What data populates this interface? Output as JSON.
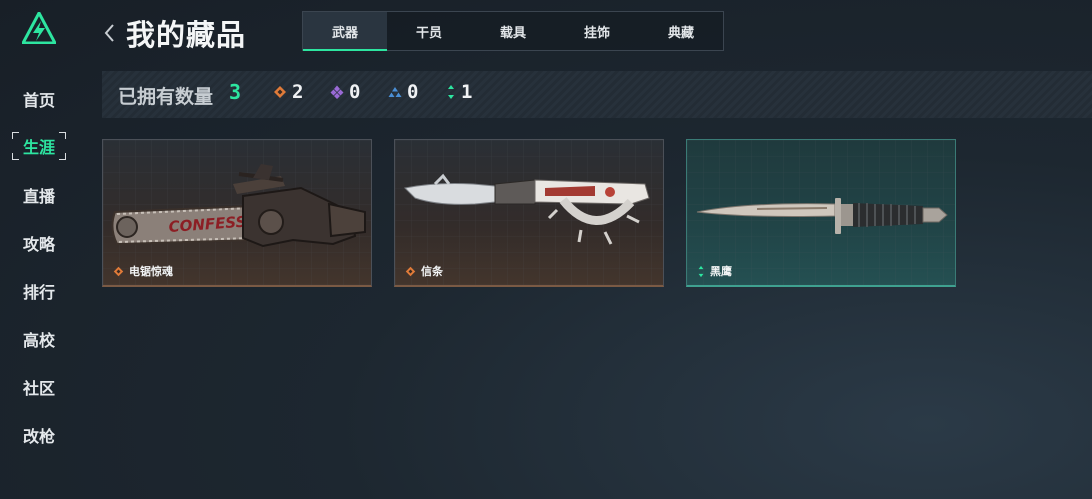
{
  "page": {
    "title": "我的藏品",
    "back_icon": "chevron-left-icon",
    "accent": "#2de5a0"
  },
  "sidebar": {
    "logo": "triangle-lightning-logo",
    "items": [
      {
        "label": "首页"
      },
      {
        "label": "生涯",
        "active": true
      },
      {
        "label": "直播"
      },
      {
        "label": "攻略"
      },
      {
        "label": "排行"
      },
      {
        "label": "高校"
      },
      {
        "label": "社区"
      },
      {
        "label": "改枪"
      }
    ]
  },
  "tabs": [
    {
      "label": "武器",
      "active": true
    },
    {
      "label": "干员"
    },
    {
      "label": "载具"
    },
    {
      "label": "挂饰"
    },
    {
      "label": "典藏"
    }
  ],
  "summary": {
    "label": "已拥有数量",
    "total": "3",
    "rarities": [
      {
        "icon": "orange-diamond-icon",
        "color": "#e07b39",
        "count": "2"
      },
      {
        "icon": "purple-diamond-icon",
        "color": "#9a6ad6",
        "count": "0"
      },
      {
        "icon": "blue-triangle-icon",
        "color": "#4a8fd6",
        "count": "0"
      },
      {
        "icon": "teal-pips-icon",
        "color": "#2de5a0",
        "count": "1"
      }
    ]
  },
  "items": [
    {
      "name": "电锯惊魂",
      "rarity": "orange",
      "art": "chainsaw"
    },
    {
      "name": "信条",
      "rarity": "orange",
      "art": "knuckle-knife"
    },
    {
      "name": "黑鹰",
      "rarity": "teal",
      "art": "combat-knife"
    }
  ]
}
